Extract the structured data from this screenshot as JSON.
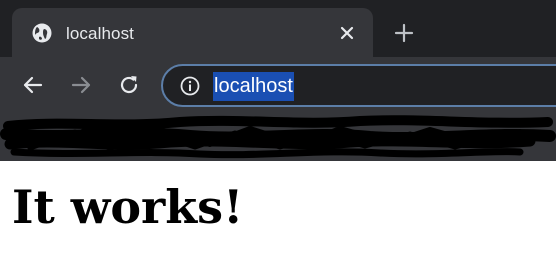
{
  "tab": {
    "title": "localhost",
    "favicon": "globe-icon",
    "close_icon": "close-icon"
  },
  "new_tab_icon": "plus-icon",
  "toolbar": {
    "back_icon": "arrow-left-icon",
    "forward_icon": "arrow-right-icon",
    "reload_icon": "reload-icon"
  },
  "omnibox": {
    "info_icon": "info-icon",
    "url": "localhost",
    "url_selected": true
  },
  "bookmarks_bar": {
    "redacted": true
  },
  "page": {
    "heading": "It works!"
  },
  "colors": {
    "frame": "#202124",
    "toolbar": "#35363a",
    "omnibox_border": "#5c7ea8",
    "selection": "#1a4fb3",
    "text": "#e8eaed"
  }
}
